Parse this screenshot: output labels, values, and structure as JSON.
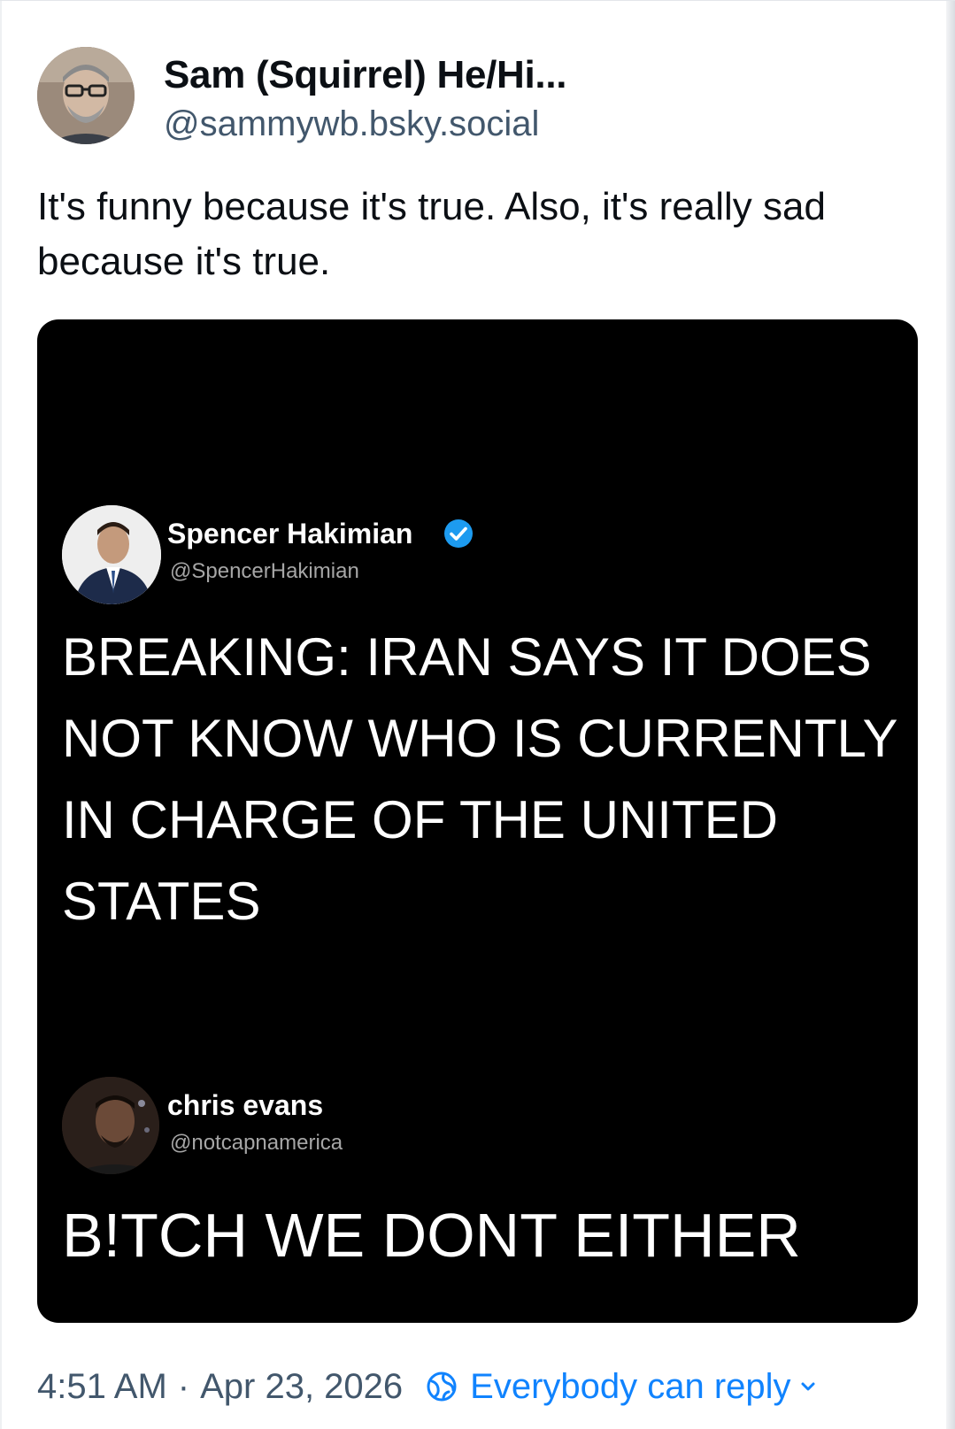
{
  "post": {
    "author": {
      "display_name": "Sam (Squirrel) He/Hi...",
      "handle": "@sammywb.bsky.social"
    },
    "text": "It's funny because it's true. Also, it's really sad because it's true.",
    "embed": {
      "quote1": {
        "name": "Spencer Hakimian",
        "handle": "@SpencerHakimian",
        "verified": true,
        "text": "BREAKING: IRAN SAYS IT DOES NOT KNOW WHO IS CURRENTLY IN CHARGE OF THE UNITED STATES"
      },
      "quote2": {
        "name": "chris evans",
        "handle": "@notcapnamerica",
        "text": "B!TCH WE DONT EITHER"
      }
    },
    "footer": {
      "time": "4:51 AM",
      "separator": "·",
      "date": "Apr 23, 2026",
      "reply_setting": "Everybody can reply"
    }
  },
  "colors": {
    "accent": "#1083fe",
    "muted": "#42576c",
    "text": "#0b0f14",
    "verified": "#1d9bf0"
  },
  "icons": {
    "verified": "verified-check-icon",
    "reply_setting": "globe-icon",
    "dropdown": "chevron-down-icon"
  }
}
